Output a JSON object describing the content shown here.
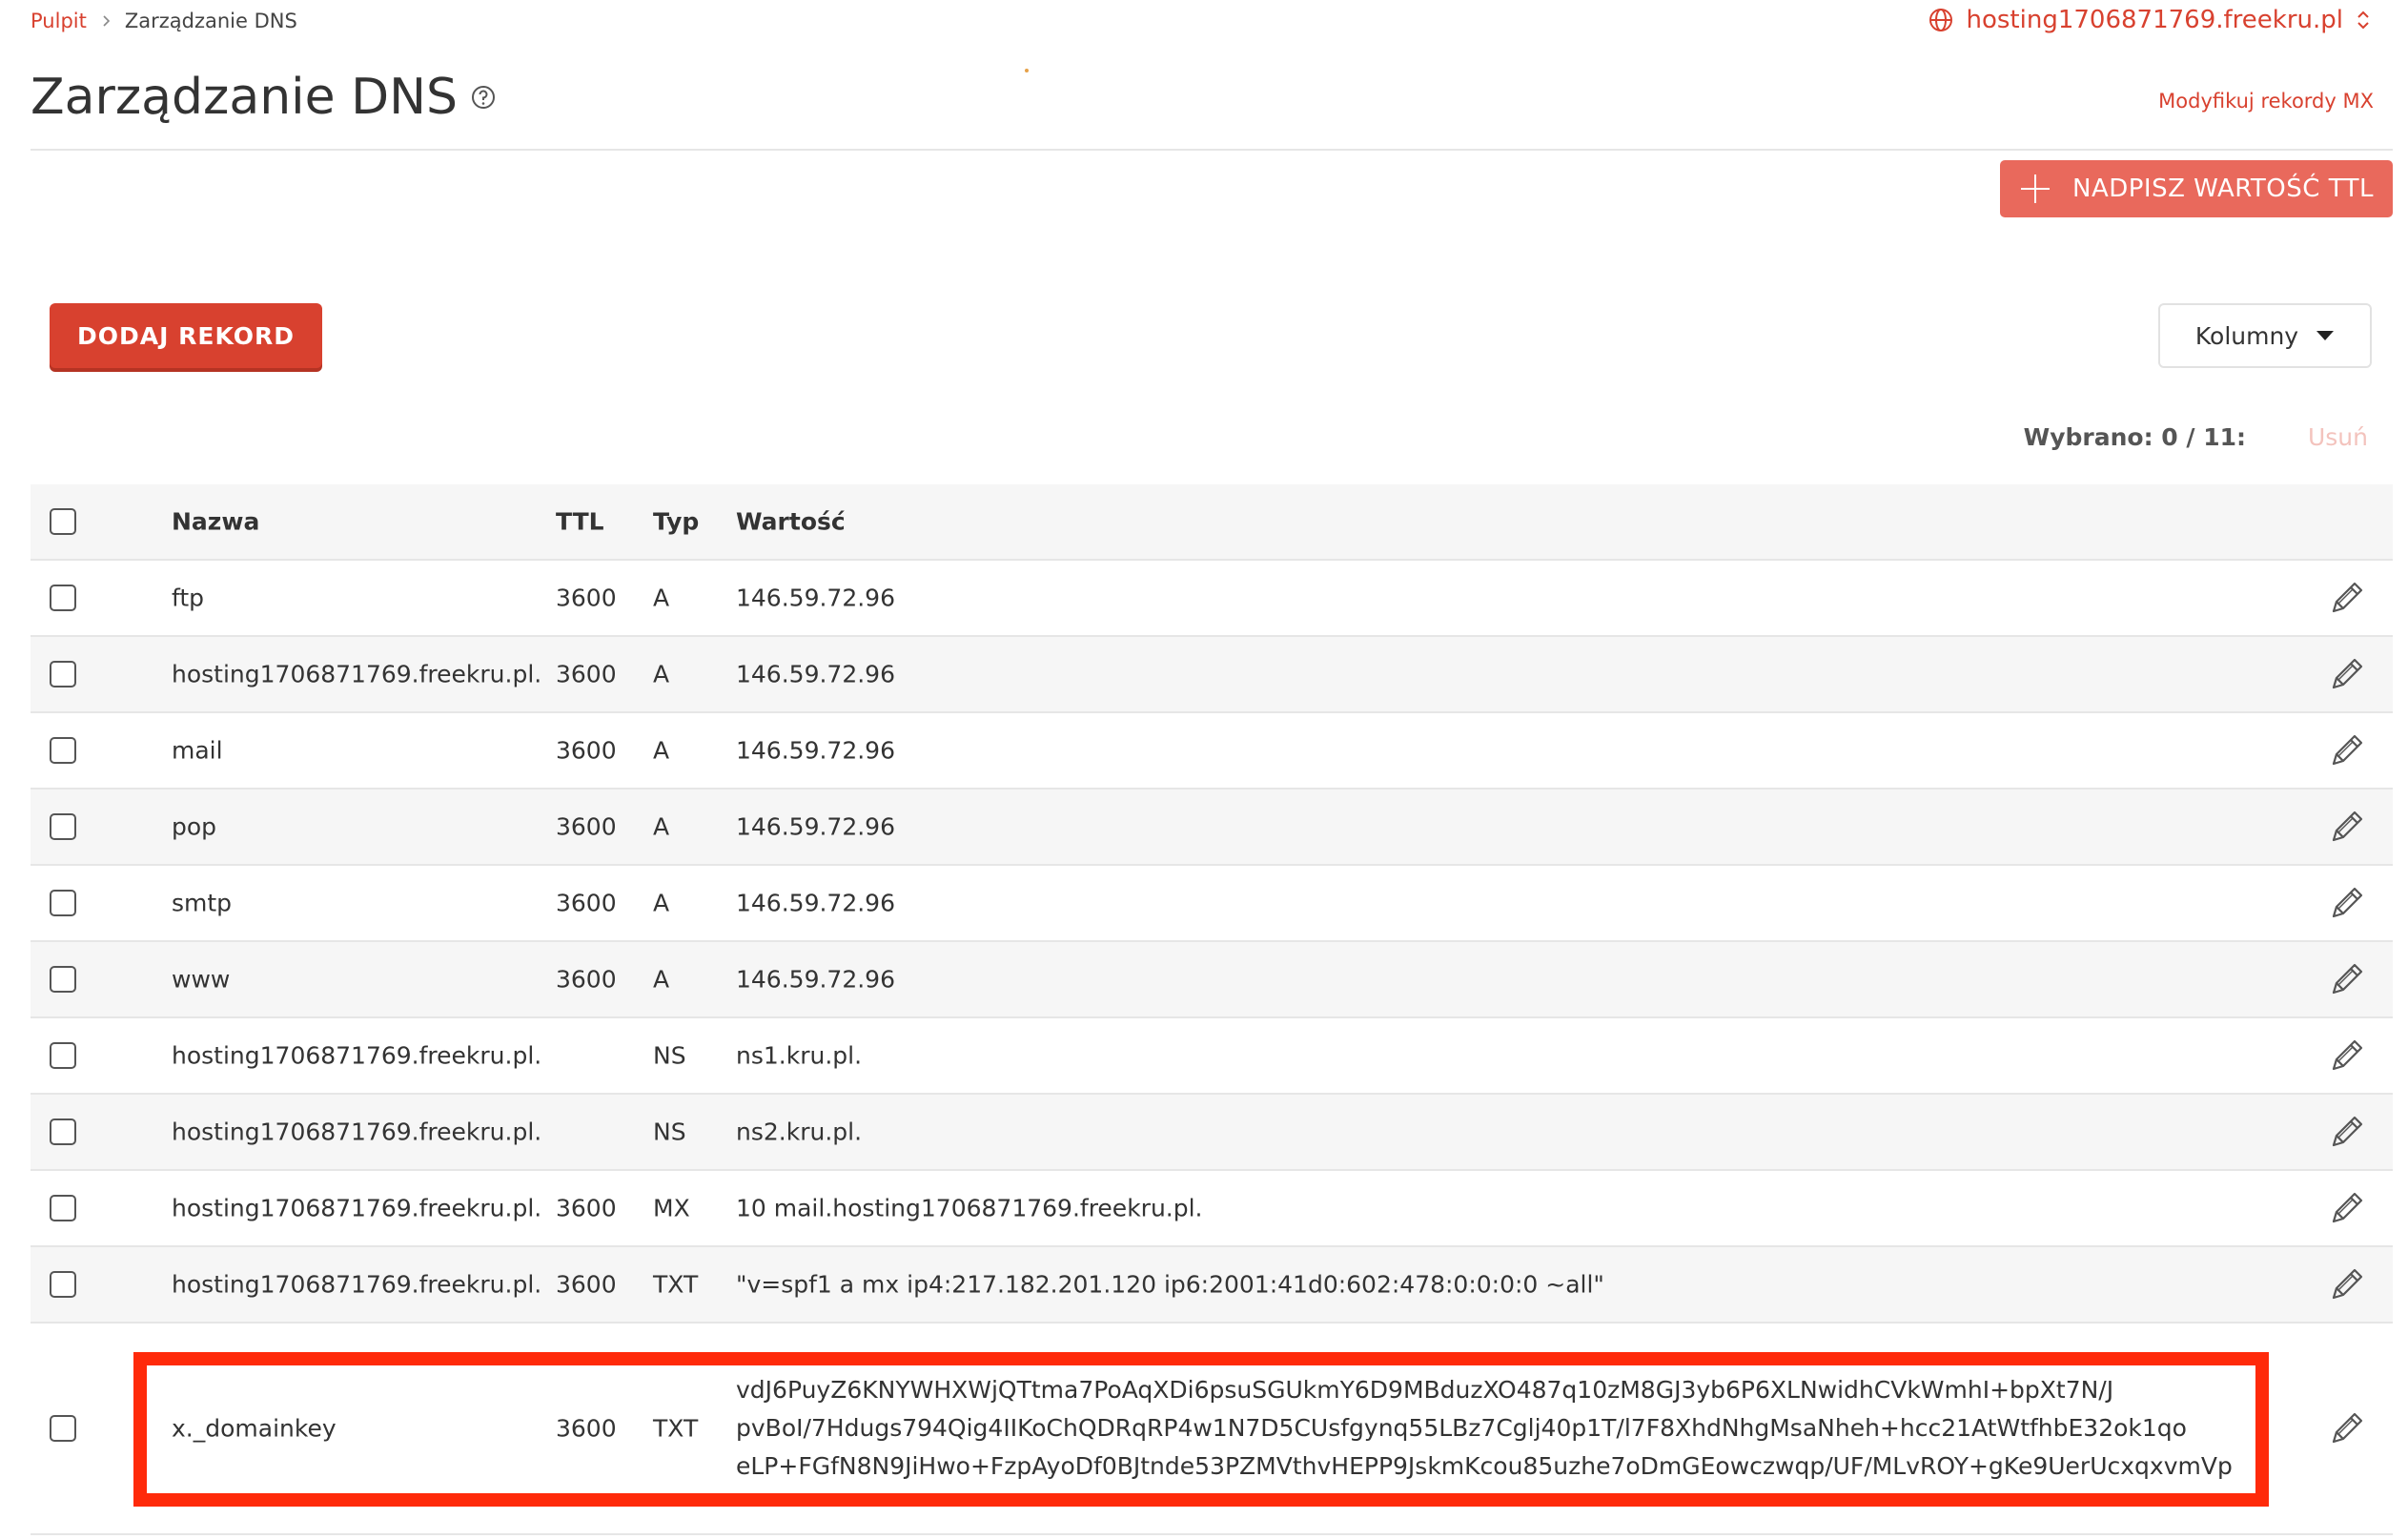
{
  "breadcrumb": {
    "home": "Pulpit",
    "current": "Zarządzanie DNS"
  },
  "domain_selector": {
    "value": "hosting1706871769.freekru.pl",
    "icon": "globe-icon"
  },
  "page": {
    "title": "Zarządzanie DNS",
    "mx_link": "Modyfikuj rekordy MX"
  },
  "toolbar": {
    "ttl_button": "NADPISZ WARTOŚĆ TTL",
    "add_record": "DODAJ REKORD",
    "columns": "Kolumny",
    "selection": "Wybrano: 0 / 11:",
    "delete": "Usuń"
  },
  "table": {
    "headers": {
      "name": "Nazwa",
      "ttl": "TTL",
      "type": "Typ",
      "value": "Wartość"
    },
    "rows": [
      {
        "name": "ftp",
        "ttl": "3600",
        "type": "A",
        "value": "146.59.72.96"
      },
      {
        "name": "hosting1706871769.freekru.pl.",
        "ttl": "3600",
        "type": "A",
        "value": "146.59.72.96"
      },
      {
        "name": "mail",
        "ttl": "3600",
        "type": "A",
        "value": "146.59.72.96"
      },
      {
        "name": "pop",
        "ttl": "3600",
        "type": "A",
        "value": "146.59.72.96"
      },
      {
        "name": "smtp",
        "ttl": "3600",
        "type": "A",
        "value": "146.59.72.96"
      },
      {
        "name": "www",
        "ttl": "3600",
        "type": "A",
        "value": "146.59.72.96"
      },
      {
        "name": "hosting1706871769.freekru.pl.",
        "ttl": "",
        "type": "NS",
        "value": "ns1.kru.pl."
      },
      {
        "name": "hosting1706871769.freekru.pl.",
        "ttl": "",
        "type": "NS",
        "value": "ns2.kru.pl."
      },
      {
        "name": "hosting1706871769.freekru.pl.",
        "ttl": "3600",
        "type": "MX",
        "value": "10 mail.hosting1706871769.freekru.pl."
      },
      {
        "name": "hosting1706871769.freekru.pl.",
        "ttl": "3600",
        "type": "TXT",
        "value": "\"v=spf1 a mx ip4:217.182.201.120 ip6:2001:41d0:602:478:0:0:0:0 ~all\""
      }
    ],
    "dkim_row": {
      "name": "x._domainkey",
      "ttl": "3600",
      "type": "TXT",
      "value_lines": [
        "vdJ6PuyZ6KNYWHXWjQTtma7PoAqXDi6psuSGUkmY6D9MBduzXO487q10zM8GJ3yb6P6XLNwidhCVkWmhI+bpXt7N/J",
        "pvBoI/7Hdugs794Qig4IIKoChQDRqRP4w1N7D5CUsfgynq55LBz7Cglj40p1T/l7F8XhdNhgMsaNheh+hcc21AtWtfhbE32ok1qo",
        "eLP+FGfN8N9JiHwo+FzpAyoDf0BJtnde53PZMVthvHEPP9JskmKcou85uzhe7oDmGEowczwqp/UF/MLvROY+gKe9UerUcxqxvmVp"
      ]
    }
  }
}
